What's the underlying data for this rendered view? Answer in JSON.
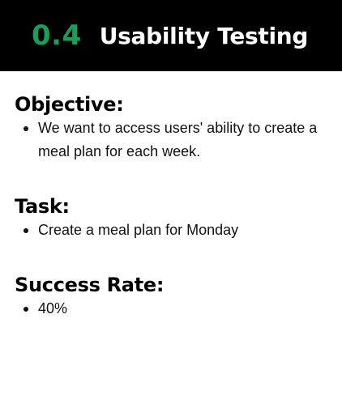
{
  "header": {
    "number": "0.4",
    "title": "Usability Testing",
    "number_color": "#1a9e5a",
    "background_color": "#000000"
  },
  "sections": [
    {
      "heading": "Objective:",
      "items": [
        "We want to access users' ability to create a meal plan for each week."
      ]
    },
    {
      "heading": "Task:",
      "items": [
        "Create a meal plan for Monday"
      ]
    },
    {
      "heading": "Success Rate:",
      "items": [
        "40%"
      ]
    }
  ]
}
